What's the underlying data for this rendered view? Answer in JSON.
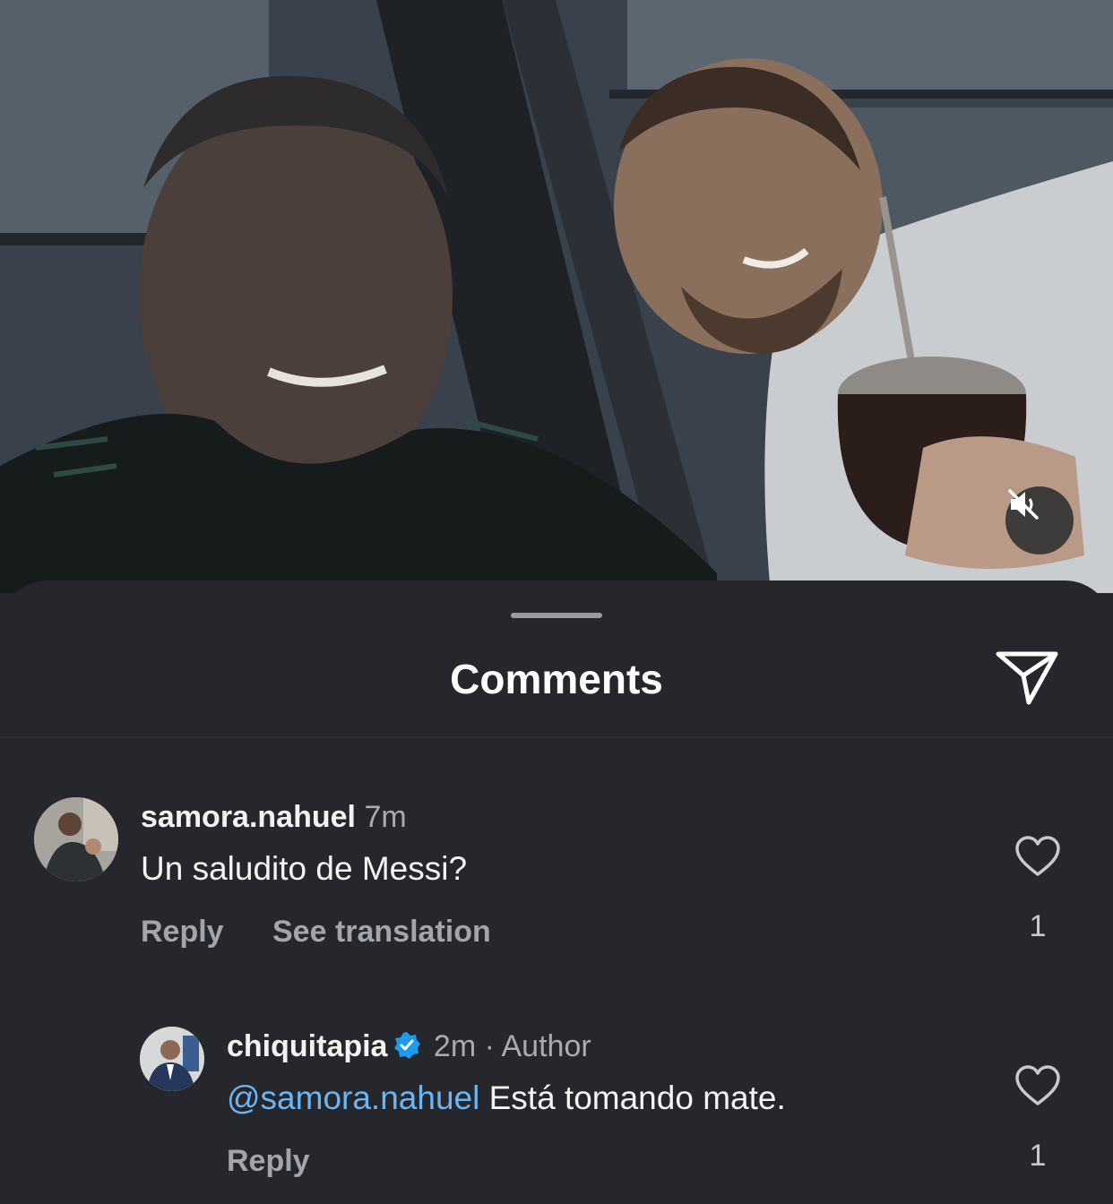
{
  "sheet": {
    "title": "Comments"
  },
  "icons": {
    "mute": "speaker-muted-icon",
    "share": "paper-plane-icon",
    "like": "heart-outline-icon",
    "verified": "verified-badge-icon"
  },
  "colors": {
    "background": "#25272d",
    "mention": "#6cb4f2",
    "verified": "#1d9bf0"
  },
  "comments": [
    {
      "username": "samora.nahuel",
      "time": "7m",
      "text": "Un saludito de Messi?",
      "reply_label": "Reply",
      "translate_label": "See translation",
      "likes": "1"
    },
    {
      "username": "chiquitapia",
      "verified": true,
      "time": "2m",
      "author_label": "· Author",
      "mention": "@samora.nahuel",
      "text": " Está tomando mate.",
      "reply_label": "Reply",
      "likes": "1"
    }
  ]
}
